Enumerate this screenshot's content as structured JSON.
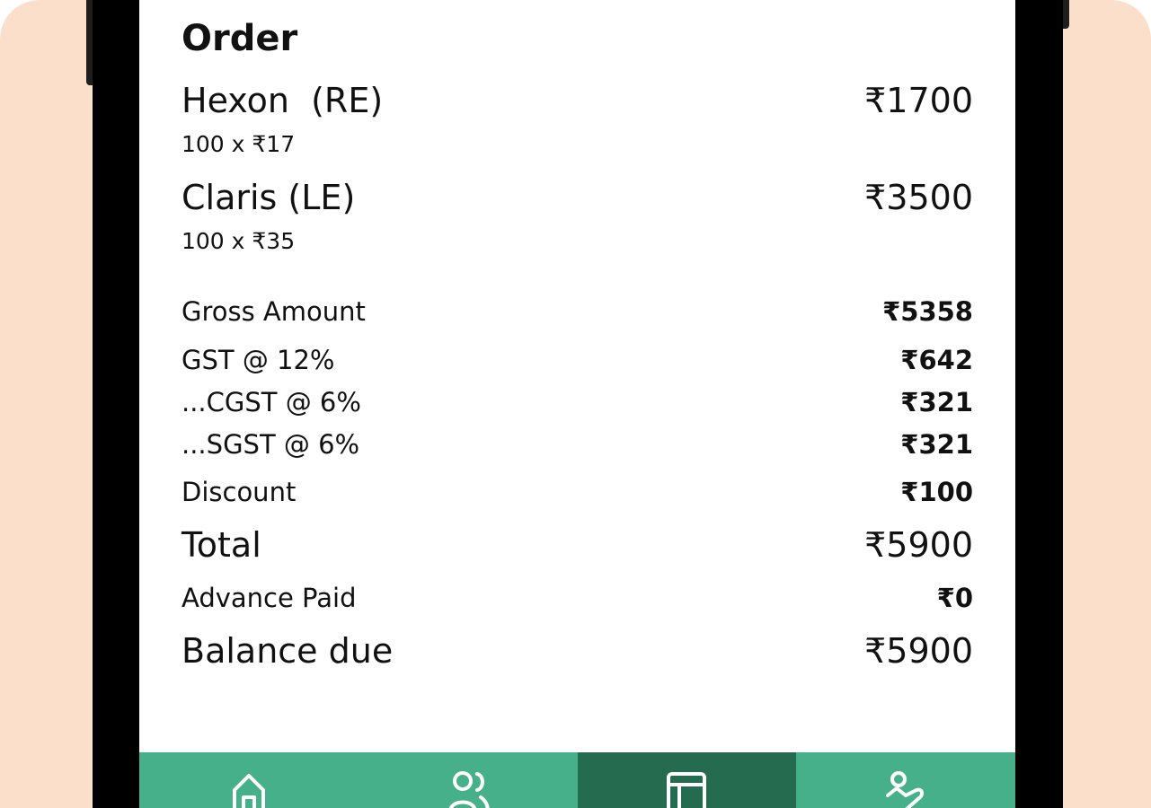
{
  "order": {
    "title": "Order",
    "items": [
      {
        "name": "Hexon  (RE)",
        "price": "₹1700",
        "qty_line": "100 x ₹17"
      },
      {
        "name": "Claris (LE)",
        "price": "₹3500",
        "qty_line": "100 x ₹35"
      }
    ],
    "summary": {
      "gross_label": "Gross Amount",
      "gross_value": "₹5358",
      "gst_label": "GST @ 12%",
      "gst_value": "₹642",
      "cgst_label": "...CGST @ 6%",
      "cgst_value": "₹321",
      "sgst_label": "...SGST @ 6%",
      "sgst_value": "₹321",
      "discount_label": "Discount",
      "discount_value": "₹100",
      "total_label": "Total",
      "total_value": "₹5900",
      "advance_label": "Advance Paid",
      "advance_value": "₹0",
      "balance_label": "Balance due",
      "balance_value": "₹5900"
    }
  },
  "bottom_nav": {
    "items": [
      {
        "icon": "home-icon",
        "active": false
      },
      {
        "icon": "users-icon",
        "active": false
      },
      {
        "icon": "layout-icon",
        "active": true
      },
      {
        "icon": "hand-holding-icon",
        "active": false
      }
    ]
  },
  "colors": {
    "background": "#fcdfca",
    "nav_bg": "#45b08a",
    "nav_active": "#256b4f"
  }
}
